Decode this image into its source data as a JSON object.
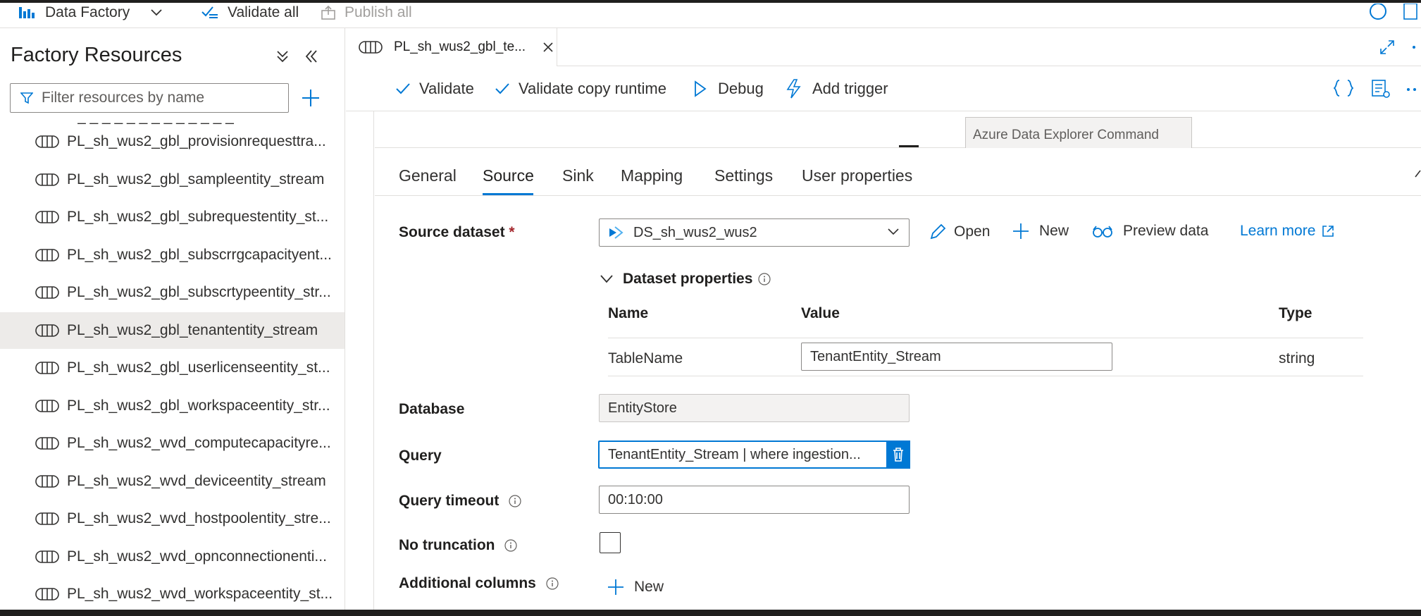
{
  "topbar": {
    "app_name": "Data Factory",
    "validate_all": "Validate all",
    "publish_all": "Publish all"
  },
  "sidebar": {
    "title": "Factory Resources",
    "filter_placeholder": "Filter resources by name",
    "items": [
      {
        "label": "PL_sh_wus2_gbl_provisionrequesttra...",
        "selected": false
      },
      {
        "label": "PL_sh_wus2_gbl_sampleentity_stream",
        "selected": false
      },
      {
        "label": "PL_sh_wus2_gbl_subrequestentity_st...",
        "selected": false
      },
      {
        "label": "PL_sh_wus2_gbl_subscrrgcapacityent...",
        "selected": false
      },
      {
        "label": "PL_sh_wus2_gbl_subscrtypeentity_str...",
        "selected": false
      },
      {
        "label": "PL_sh_wus2_gbl_tenantentity_stream",
        "selected": true
      },
      {
        "label": "PL_sh_wus2_gbl_userlicenseentity_st...",
        "selected": false
      },
      {
        "label": "PL_sh_wus2_gbl_workspaceentity_str...",
        "selected": false
      },
      {
        "label": "PL_sh_wus2_wvd_computecapacityre...",
        "selected": false
      },
      {
        "label": "PL_sh_wus2_wvd_deviceentity_stream",
        "selected": false
      },
      {
        "label": "PL_sh_wus2_wvd_hostpoolentity_stre...",
        "selected": false
      },
      {
        "label": "PL_sh_wus2_wvd_opnconnectionenti...",
        "selected": false
      },
      {
        "label": "PL_sh_wus2_wvd_workspaceentity_st...",
        "selected": false
      }
    ]
  },
  "editor": {
    "tab_title": "PL_sh_wus2_gbl_te...",
    "toolbar": {
      "validate": "Validate",
      "validate_copy_runtime": "Validate copy runtime",
      "debug": "Debug",
      "add_trigger": "Add trigger"
    },
    "activity_label": "Azure Data Explorer Command"
  },
  "properties": {
    "tabs": [
      {
        "label": "General",
        "active": false
      },
      {
        "label": "Source",
        "active": true
      },
      {
        "label": "Sink",
        "active": false
      },
      {
        "label": "Mapping",
        "active": false
      },
      {
        "label": "Settings",
        "active": false
      },
      {
        "label": "User properties",
        "active": false
      }
    ],
    "source_dataset_label": "Source dataset",
    "required_mark": "*",
    "source_dataset_value": "DS_sh_wus2_wus2",
    "open": "Open",
    "new": "New",
    "preview_data": "Preview data",
    "learn_more": "Learn more",
    "dataset_properties": "Dataset properties",
    "table_headers": {
      "name": "Name",
      "value": "Value",
      "type": "Type"
    },
    "table_row": {
      "name": "TableName",
      "value": "TenantEntity_Stream",
      "type": "string"
    },
    "database_label": "Database",
    "database_value": "EntityStore",
    "query_label": "Query",
    "query_value": "TenantEntity_Stream | where ingestion...",
    "query_timeout_label": "Query timeout",
    "query_timeout_value": "00:10:00",
    "no_truncation_label": "No truncation",
    "no_truncation_checked": false,
    "additional_columns_label": "Additional columns",
    "additional_new": "New"
  },
  "colors": {
    "accent": "#0078d4",
    "selected_row": "#edebe9"
  }
}
